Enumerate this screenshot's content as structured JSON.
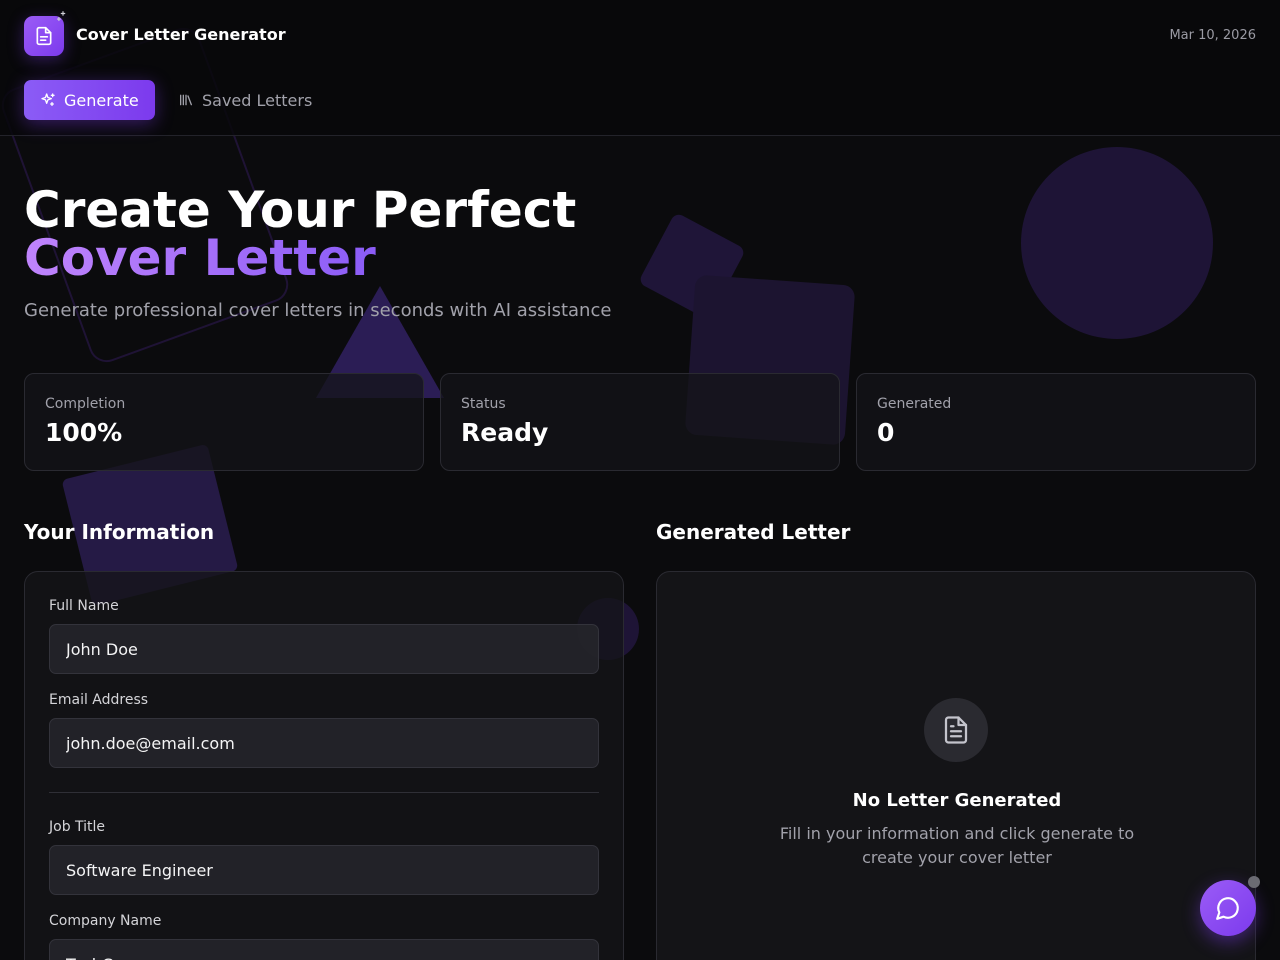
{
  "header": {
    "app_title": "Cover Letter Generator",
    "date": "Mar 10, 2026"
  },
  "nav": {
    "generate_label": "Generate",
    "saved_label": "Saved Letters"
  },
  "hero": {
    "title_line1": "Create Your Perfect",
    "title_line2": "Cover Letter",
    "subtitle": "Generate professional cover letters in seconds with AI assistance"
  },
  "stats": [
    {
      "label": "Completion",
      "value": "100%"
    },
    {
      "label": "Status",
      "value": "Ready"
    },
    {
      "label": "Generated",
      "value": "0"
    }
  ],
  "form": {
    "section_title": "Your Information",
    "fields": {
      "full_name": {
        "label": "Full Name",
        "value": "John Doe"
      },
      "email": {
        "label": "Email Address",
        "value": "john.doe@email.com"
      },
      "job_title": {
        "label": "Job Title",
        "value": "Software Engineer"
      },
      "company": {
        "label": "Company Name",
        "value": "TechCorp"
      }
    }
  },
  "letter": {
    "section_title": "Generated Letter",
    "empty_title": "No Letter Generated",
    "empty_desc": "Fill in your information and click generate to create your cover letter"
  },
  "icons": {
    "logo": "document-icon",
    "sparkle": "sparkle-icon",
    "generate": "sparkles-icon",
    "saved": "library-icon",
    "empty": "document-icon",
    "chat": "chat-bubble-icon"
  },
  "colors": {
    "accent": "#8b5cf6",
    "accent_dark": "#7c3aed",
    "background": "#0b0b0d"
  }
}
